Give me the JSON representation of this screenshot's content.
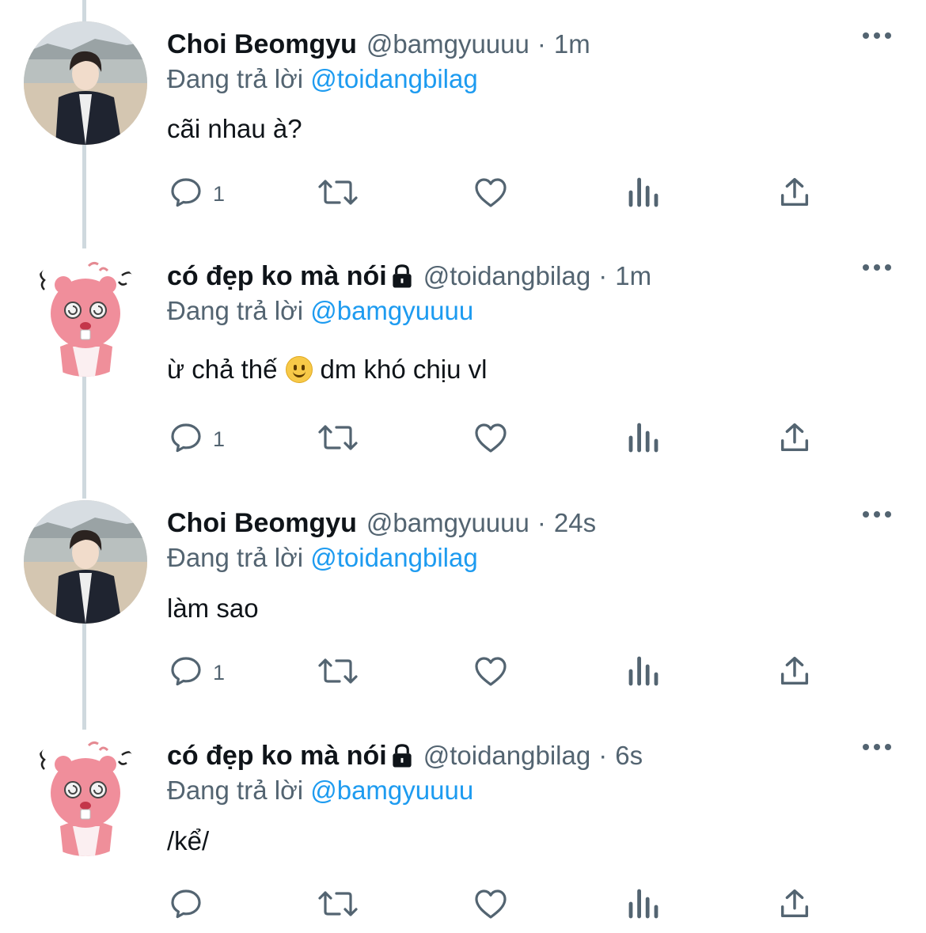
{
  "colors": {
    "text": "#0f1419",
    "secondary": "#536471",
    "accent": "#1d9bf0",
    "thread_line": "#cfd9de"
  },
  "tweets": [
    {
      "avatar": "boy-photo-avatar",
      "name": "Choi Beomgyu",
      "locked": false,
      "handle": "@bamgyuuuu",
      "dot": "·",
      "time": "1m",
      "reply_prefix": "Đang trả lời",
      "reply_to": "@toidangbilag",
      "text": "cãi nhau à?",
      "reply_count": "1"
    },
    {
      "avatar": "pink-beaver-avatar",
      "name": "có đẹp ko mà nói",
      "locked": true,
      "handle": "@toidangbilag",
      "dot": "·",
      "time": "1m",
      "reply_prefix": "Đang trả lời",
      "reply_to": "@bamgyuuuu",
      "text_before": "ừ chả thế",
      "emoji": "slightly-smiling-face",
      "text_after": "dm khó chịu vl",
      "reply_count": "1"
    },
    {
      "avatar": "boy-photo-avatar",
      "name": "Choi Beomgyu",
      "locked": false,
      "handle": "@bamgyuuuu",
      "dot": "·",
      "time": "24s",
      "reply_prefix": "Đang trả lời",
      "reply_to": "@toidangbilag",
      "text": "làm sao",
      "reply_count": "1"
    },
    {
      "avatar": "pink-beaver-avatar",
      "name": "có đẹp ko mà nói",
      "locked": true,
      "handle": "@toidangbilag",
      "dot": "·",
      "time": "6s",
      "reply_prefix": "Đang trả lời",
      "reply_to": "@bamgyuuuu",
      "text": "/kể/",
      "reply_count": ""
    }
  ],
  "action_icons": [
    "reply-icon",
    "retweet-icon",
    "like-icon",
    "views-icon",
    "share-icon"
  ]
}
